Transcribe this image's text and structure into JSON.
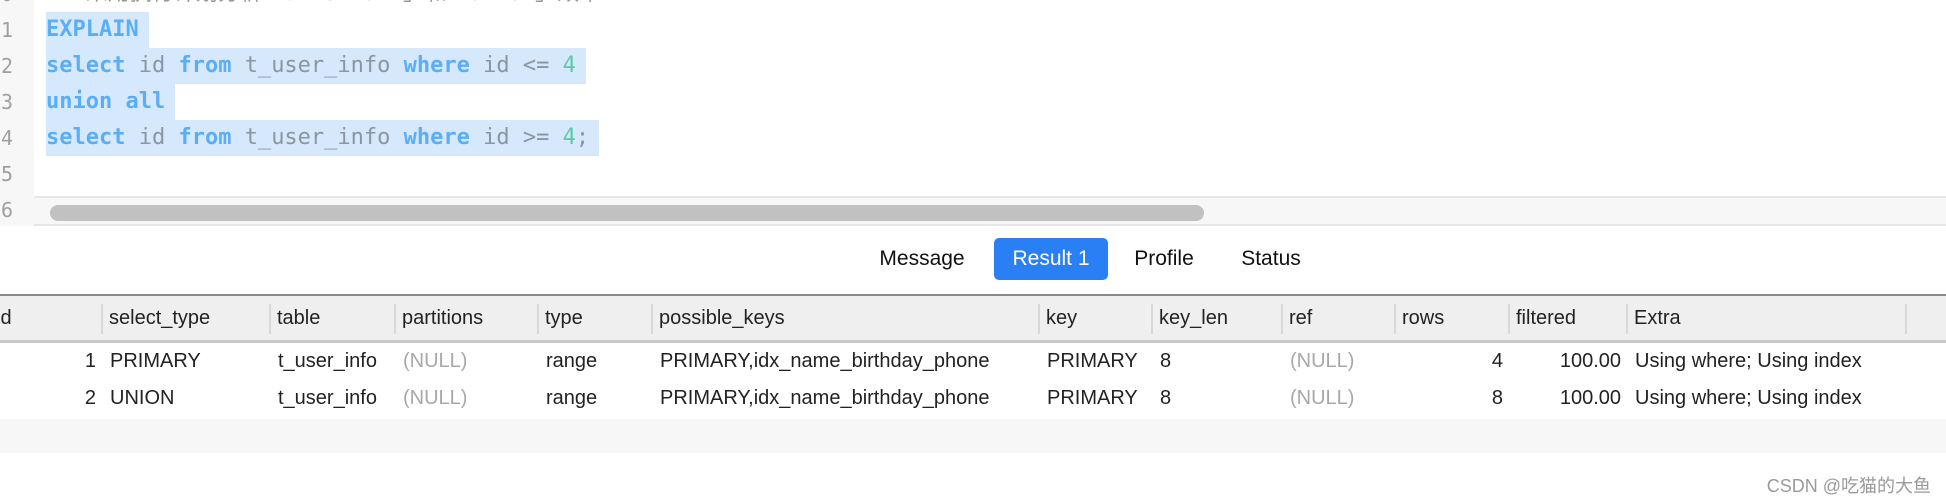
{
  "editor": {
    "line_numbers": [
      "0",
      "1",
      "2",
      "3",
      "4",
      "5",
      "6"
    ],
    "comment": "-- 采用执行计划分析「union all」和「union」效率",
    "lines": [
      {
        "parts": [
          {
            "t": "EXPLAIN",
            "c": "kw"
          }
        ]
      },
      {
        "parts": [
          {
            "t": "select",
            "c": "kw"
          },
          {
            "t": " id ",
            "c": ""
          },
          {
            "t": "from",
            "c": "kw"
          },
          {
            "t": " t_user_info ",
            "c": ""
          },
          {
            "t": "where",
            "c": "kw"
          },
          {
            "t": " id <= ",
            "c": ""
          },
          {
            "t": "4",
            "c": "num"
          }
        ]
      },
      {
        "parts": [
          {
            "t": "union all",
            "c": "kw"
          }
        ]
      },
      {
        "parts": [
          {
            "t": "select",
            "c": "kw"
          },
          {
            "t": " id ",
            "c": ""
          },
          {
            "t": "from",
            "c": "kw"
          },
          {
            "t": " t_user_info ",
            "c": ""
          },
          {
            "t": "where",
            "c": "kw"
          },
          {
            "t": " id >= ",
            "c": ""
          },
          {
            "t": "4",
            "c": "num"
          },
          {
            "t": ";",
            "c": ""
          }
        ]
      }
    ]
  },
  "tabs": [
    {
      "label": "Message",
      "active": false
    },
    {
      "label": "Result 1",
      "active": true
    },
    {
      "label": "Profile",
      "active": false
    },
    {
      "label": "Status",
      "active": false
    }
  ],
  "colors": {
    "accent": "#2a7ff4",
    "keyword": "#5aaef5",
    "number": "#5cc9a7",
    "selection": "#d6e8fc"
  },
  "table": {
    "columns": [
      "id",
      "select_type",
      "table",
      "partitions",
      "type",
      "possible_keys",
      "key",
      "key_len",
      "ref",
      "rows",
      "filtered",
      "Extra"
    ],
    "rows": [
      [
        "1",
        "PRIMARY",
        "t_user_info",
        "(NULL)",
        "range",
        "PRIMARY,idx_name_birthday_phone",
        "PRIMARY",
        "8",
        "(NULL)",
        "4",
        "100.00",
        "Using where; Using index"
      ],
      [
        "2",
        "UNION",
        "t_user_info",
        "(NULL)",
        "range",
        "PRIMARY,idx_name_birthday_phone",
        "PRIMARY",
        "8",
        "(NULL)",
        "8",
        "100.00",
        "Using where; Using index"
      ]
    ]
  },
  "watermark": "CSDN @吃猫的大鱼"
}
